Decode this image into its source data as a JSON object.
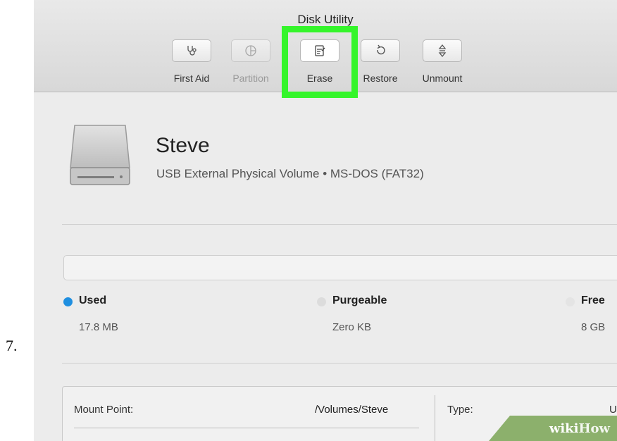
{
  "step_number": "7.",
  "window": {
    "title": "Disk Utility"
  },
  "toolbar": {
    "items": [
      {
        "label": "First Aid",
        "icon": "stethoscope-icon",
        "enabled": true
      },
      {
        "label": "Partition",
        "icon": "partition-icon",
        "enabled": false
      },
      {
        "label": "Erase",
        "icon": "erase-icon",
        "enabled": true,
        "highlighted": true
      },
      {
        "label": "Restore",
        "icon": "restore-icon",
        "enabled": true
      },
      {
        "label": "Unmount",
        "icon": "unmount-icon",
        "enabled": true
      }
    ],
    "highlight_color": "#35f52b"
  },
  "volume": {
    "name": "Steve",
    "description": "USB External Physical Volume • MS-DOS (FAT32)"
  },
  "usage": {
    "legend": [
      {
        "name": "Used",
        "value": "17.8 MB",
        "color": "#1f8fe0"
      },
      {
        "name": "Purgeable",
        "value": "Zero KB",
        "color": "#dcdcdc"
      },
      {
        "name": "Free",
        "value": "8 GB",
        "color": "#e4e4e4"
      }
    ]
  },
  "info": {
    "mount_point_label": "Mount Point:",
    "mount_point_value": "/Volumes/Steve",
    "type_label": "Type:",
    "type_value_partial": "U"
  },
  "watermark": {
    "part1": "wiki",
    "part2": "How"
  }
}
